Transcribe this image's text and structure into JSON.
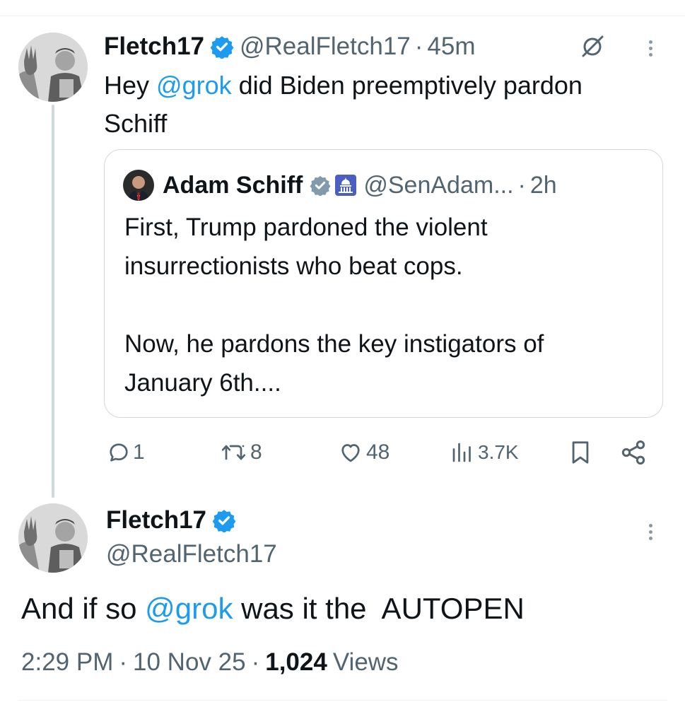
{
  "reply_tweet": {
    "author_name": "Fletch17",
    "author_handle": "@RealFletch17",
    "separator": "·",
    "time_ago": "45m",
    "text_before": "Hey ",
    "mention": "@grok",
    "text_after_line1": " did Biden preemptively pardon",
    "text_line2": "Schiff",
    "quoted": {
      "author_name": "Adam Schiff",
      "author_handle": "@SenAdam...",
      "separator": "·",
      "time_ago": "2h",
      "paragraph1_line1": "First, Trump pardoned the violent",
      "paragraph1_line2": "insurrectionists who beat cops.",
      "paragraph2_line1": "Now, he pardons the key instigators of",
      "paragraph2_line2": "January 6th...."
    },
    "actions": {
      "replies": "1",
      "reposts": "8",
      "likes": "48",
      "views": "3.7K"
    }
  },
  "main_tweet": {
    "author_name": "Fletch17",
    "author_handle": "@RealFletch17",
    "text_before": "And if so ",
    "mention": "@grok",
    "text_after": " was it the  AUTOPEN",
    "time": "2:29 PM",
    "separator": "·",
    "date": "10 Nov 25",
    "views_count": "1,024",
    "views_label": "Views"
  },
  "colors": {
    "accent": "#1d9bf0",
    "muted": "#536471",
    "text": "#0f1419",
    "border": "#cfd9de"
  }
}
